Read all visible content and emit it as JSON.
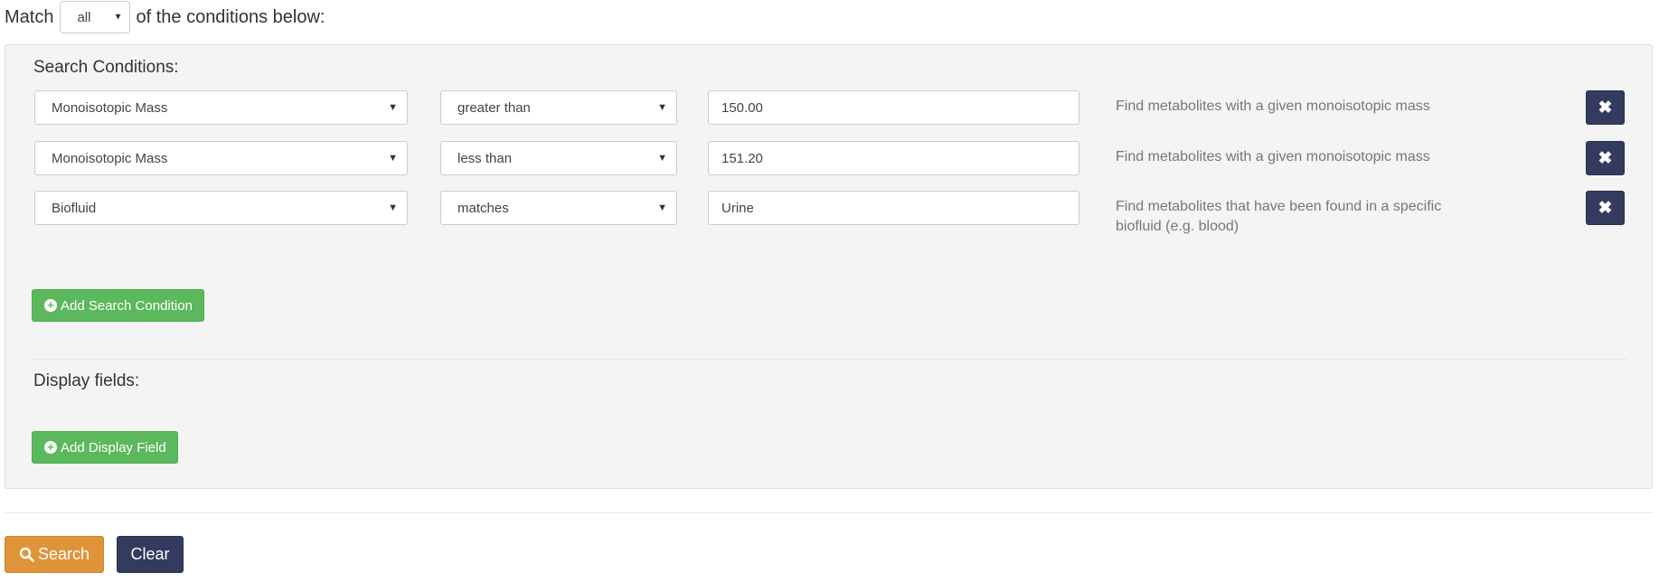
{
  "match": {
    "prefix": "Match",
    "mode": "all",
    "suffix": "of the conditions below:"
  },
  "search_conditions": {
    "title": "Search Conditions:",
    "rows": [
      {
        "field": "Monoisotopic Mass",
        "operator": "greater than",
        "value": "150.00",
        "description": "Find metabolites with a given monoisotopic mass"
      },
      {
        "field": "Monoisotopic Mass",
        "operator": "less than",
        "value": "151.20",
        "description": "Find metabolites with a given monoisotopic mass"
      },
      {
        "field": "Biofluid",
        "operator": "matches",
        "value": "Urine",
        "description": "Find metabolites that have been found in a specific biofluid (e.g. blood)"
      }
    ],
    "add_label": "Add Search Condition"
  },
  "display_fields": {
    "title": "Display fields:",
    "add_label": "Add Display Field"
  },
  "actions": {
    "search_label": "Search",
    "clear_label": "Clear"
  },
  "icons": {
    "caret": "caret-down-icon",
    "remove": "times-icon",
    "add": "plus-circle-icon",
    "search": "search-icon"
  },
  "colors": {
    "panel_bg": "#f4f4f4",
    "add_button": "#5cb85c",
    "remove_button": "#333b5e",
    "search_button": "#e09439",
    "clear_button": "#333b5e"
  }
}
